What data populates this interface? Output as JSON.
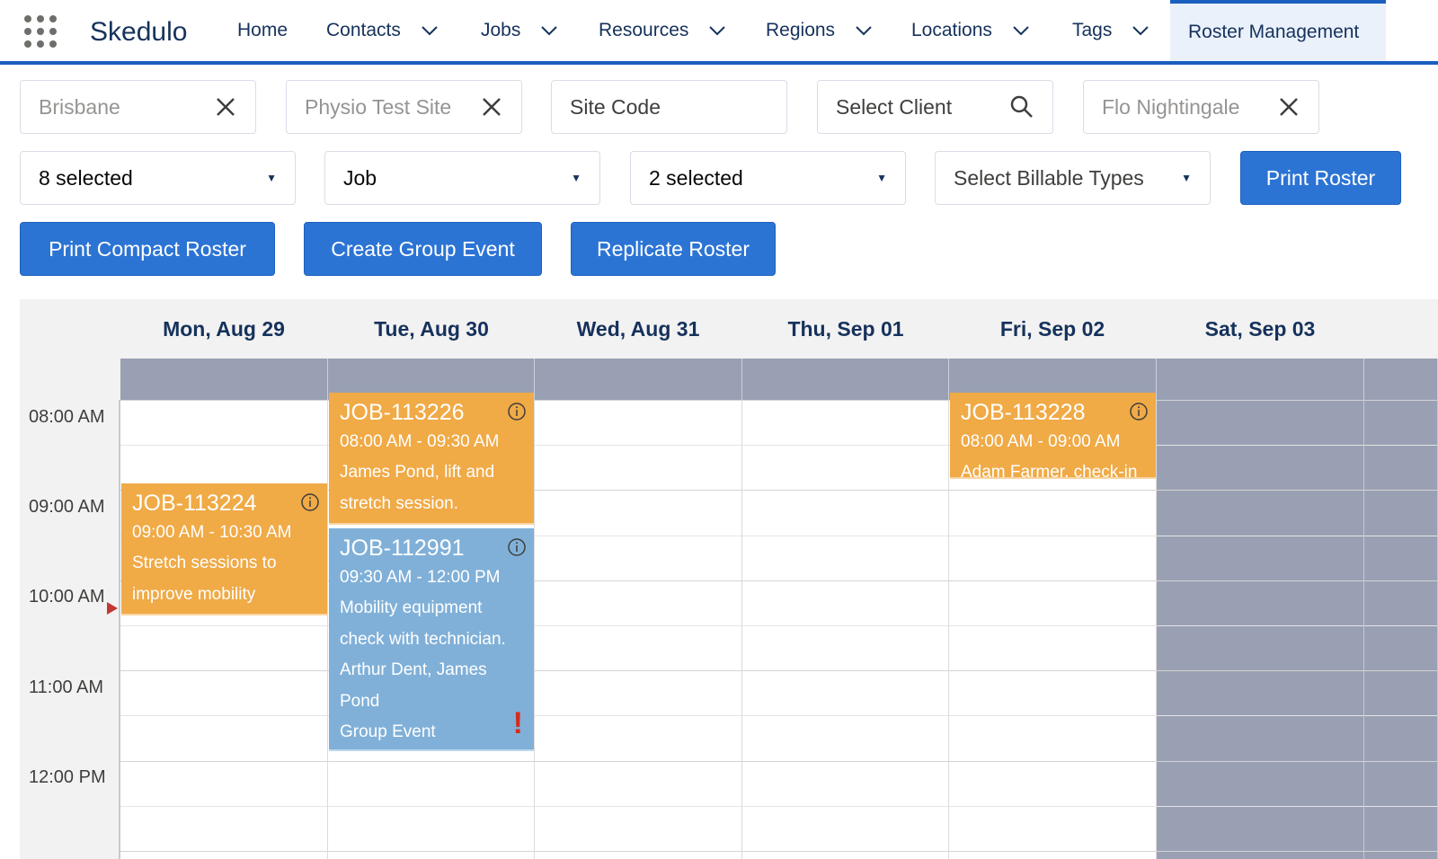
{
  "app": {
    "name": "Skedulo"
  },
  "nav": {
    "items": [
      {
        "label": "Home",
        "has_menu": false
      },
      {
        "label": "Contacts",
        "has_menu": true
      },
      {
        "label": "Jobs",
        "has_menu": true
      },
      {
        "label": "Resources",
        "has_menu": true
      },
      {
        "label": "Regions",
        "has_menu": true
      },
      {
        "label": "Locations",
        "has_menu": true
      },
      {
        "label": "Tags",
        "has_menu": true
      },
      {
        "label": "Roster Management",
        "active": true
      }
    ]
  },
  "filters": {
    "region": {
      "value": "Brisbane"
    },
    "site": {
      "value": "Physio Test Site"
    },
    "site_code": {
      "placeholder": "Site Code"
    },
    "client": {
      "placeholder": "Select Client"
    },
    "resource": {
      "value": "Flo Nightingale"
    },
    "select1": {
      "value": "8 selected"
    },
    "select2": {
      "value": "Job"
    },
    "select3": {
      "value": "2 selected"
    },
    "select4": {
      "value": "Select Billable Types"
    }
  },
  "buttons": {
    "print_roster": "Print Roster",
    "print_compact": "Print Compact Roster",
    "create_group_event": "Create Group Event",
    "replicate_roster": "Replicate Roster"
  },
  "calendar": {
    "days": [
      "Mon, Aug 29",
      "Tue, Aug 30",
      "Wed, Aug 31",
      "Thu, Sep 01",
      "Fri, Sep 02",
      "Sat, Sep 03"
    ],
    "weekend_days": [
      "Sat, Sep 03"
    ],
    "times": [
      "08:00 AM",
      "09:00 AM",
      "10:00 AM",
      "11:00 AM",
      "12:00 PM"
    ],
    "events": [
      {
        "id": "JOB-113224",
        "time": "09:00 AM - 10:30 AM",
        "desc": "Stretch sessions to improve mobility",
        "day": "Mon, Aug 29",
        "color": "#f0aa46"
      },
      {
        "id": "JOB-113226",
        "time": "08:00 AM - 09:30 AM",
        "desc": "James Pond, lift and stretch session.",
        "day": "Tue, Aug 30",
        "color": "#f0aa46"
      },
      {
        "id": "JOB-112991",
        "time": "09:30 AM - 12:00 PM",
        "desc": "Mobility equipment check with technician.",
        "desc2": "Arthur Dent, James Pond",
        "desc3": "Group Event",
        "day": "Tue, Aug 30",
        "color": "#80b0d8",
        "warning": "!"
      },
      {
        "id": "JOB-113228",
        "time": "08:00 AM - 09:00 AM",
        "desc": "Adam Farmer, check-in",
        "day": "Fri, Sep 02",
        "color": "#f0aa46"
      }
    ]
  },
  "colors": {
    "accent": "#2c74d4",
    "event_orange": "#f0aa46",
    "event_blue": "#80b0d8",
    "weekend": "#9aa0b3"
  }
}
